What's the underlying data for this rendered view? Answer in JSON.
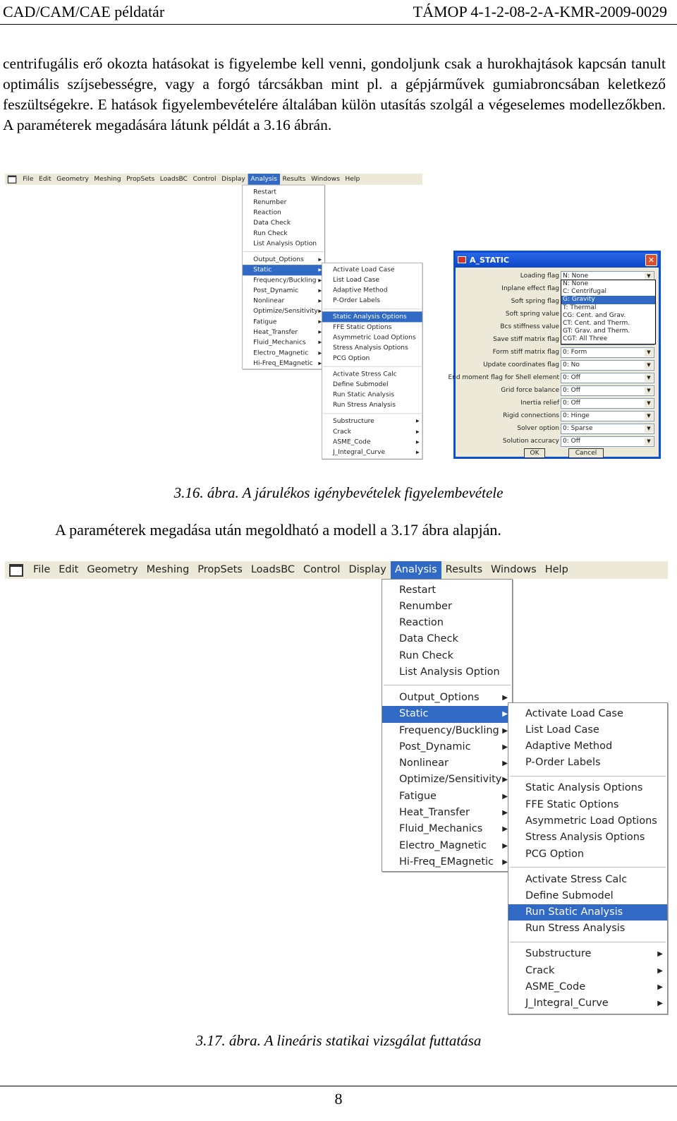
{
  "header": {
    "left": "CAD/CAM/CAE példatár",
    "right": "TÁMOP 4-1-2-08-2-A-KMR-2009-0029"
  },
  "paragraph": "centrifugális erő okozta hatásokat is figyelembe kell venni, gondoljunk csak a hurokhajtások kapcsán tanult optimális szíjsebességre, vagy a forgó tárcsákban mint pl. a gépjárművek gumiabroncsában keletkező feszültségekre. E hatások figyelembevételére általában külön utasítás szolgál a végeselemes modellezőkben. A paraméterek megadására látunk példát a 3.16 ábrán.",
  "menubar": [
    "File",
    "Edit",
    "Geometry",
    "Meshing",
    "PropSets",
    "LoadsBC",
    "Control",
    "Display",
    "Analysis",
    "Results",
    "Windows",
    "Help"
  ],
  "analysis_menu": {
    "group1": [
      "Restart",
      "Renumber",
      "Reaction",
      "Data Check",
      "Run Check",
      "List Analysis Option"
    ],
    "group2": [
      "Output_Options",
      "Static",
      "Frequency/Buckling",
      "Post_Dynamic",
      "Nonlinear",
      "Optimize/Sensitivity",
      "Fatigue",
      "Heat_Transfer",
      "Fluid_Mechanics",
      "Electro_Magnetic",
      "Hi-Freq_EMagnetic"
    ]
  },
  "static_menu": {
    "group1": [
      "Activate Load Case",
      "List Load Case",
      "Adaptive Method",
      "P-Order Labels"
    ],
    "group2": [
      "Static Analysis Options",
      "FFE Static Options",
      "Asymmetric Load Options",
      "Stress Analysis Options",
      "PCG Option"
    ],
    "group3": [
      "Activate Stress Calc",
      "Define Submodel",
      "Run Static Analysis",
      "Run Stress Analysis"
    ],
    "group4": [
      "Substructure",
      "Crack",
      "ASME_Code",
      "J_Integral_Curve"
    ]
  },
  "dialog": {
    "title": "A_STATIC",
    "rows": [
      {
        "label": "Loading flag",
        "value": "N: None"
      },
      {
        "label": "Inplane effect flag",
        "value": ""
      },
      {
        "label": "Soft spring flag",
        "value": ""
      },
      {
        "label": "Soft spring value",
        "value": ""
      },
      {
        "label": "Bcs stiffness value",
        "value": ""
      },
      {
        "label": "Save stiff matrix flag",
        "value": ""
      },
      {
        "label": "Form stiff matrix flag",
        "value": "0: Form"
      },
      {
        "label": "Update coordinates flag",
        "value": "0: No"
      },
      {
        "label": "End moment flag for Shell element",
        "value": "0: Off"
      },
      {
        "label": "Grid force balance",
        "value": "0: Off"
      },
      {
        "label": "Inertia relief",
        "value": "0: Off"
      },
      {
        "label": "Rigid connections",
        "value": "0: Hinge"
      },
      {
        "label": "Solver option",
        "value": "0: Sparse"
      },
      {
        "label": "Solution accuracy",
        "value": "0: Off"
      }
    ],
    "dropdown_options": [
      "N: None",
      "C: Centrifugal",
      "G: Gravity",
      "T: Thermal",
      "CG: Cent. and Grav.",
      "CT: Cent. and Therm.",
      "GT: Grav. and Therm.",
      "CGT: All Three"
    ],
    "selected_option": "G: Gravity",
    "ok": "OK",
    "cancel": "Cancel"
  },
  "caption1": "3.16. ábra. A járulékos igénybevételek figyelembevétele",
  "text2": "A paraméterek megadása után megoldható a modell a 3.17 ábra alapján.",
  "caption2": "3.17. ábra. A lineáris statikai vizsgálat futtatása",
  "page_number": "8",
  "colors": {
    "highlight": "#316ac5",
    "menubar": "#ece9d8",
    "dialog_border": "#0a4fd8"
  }
}
